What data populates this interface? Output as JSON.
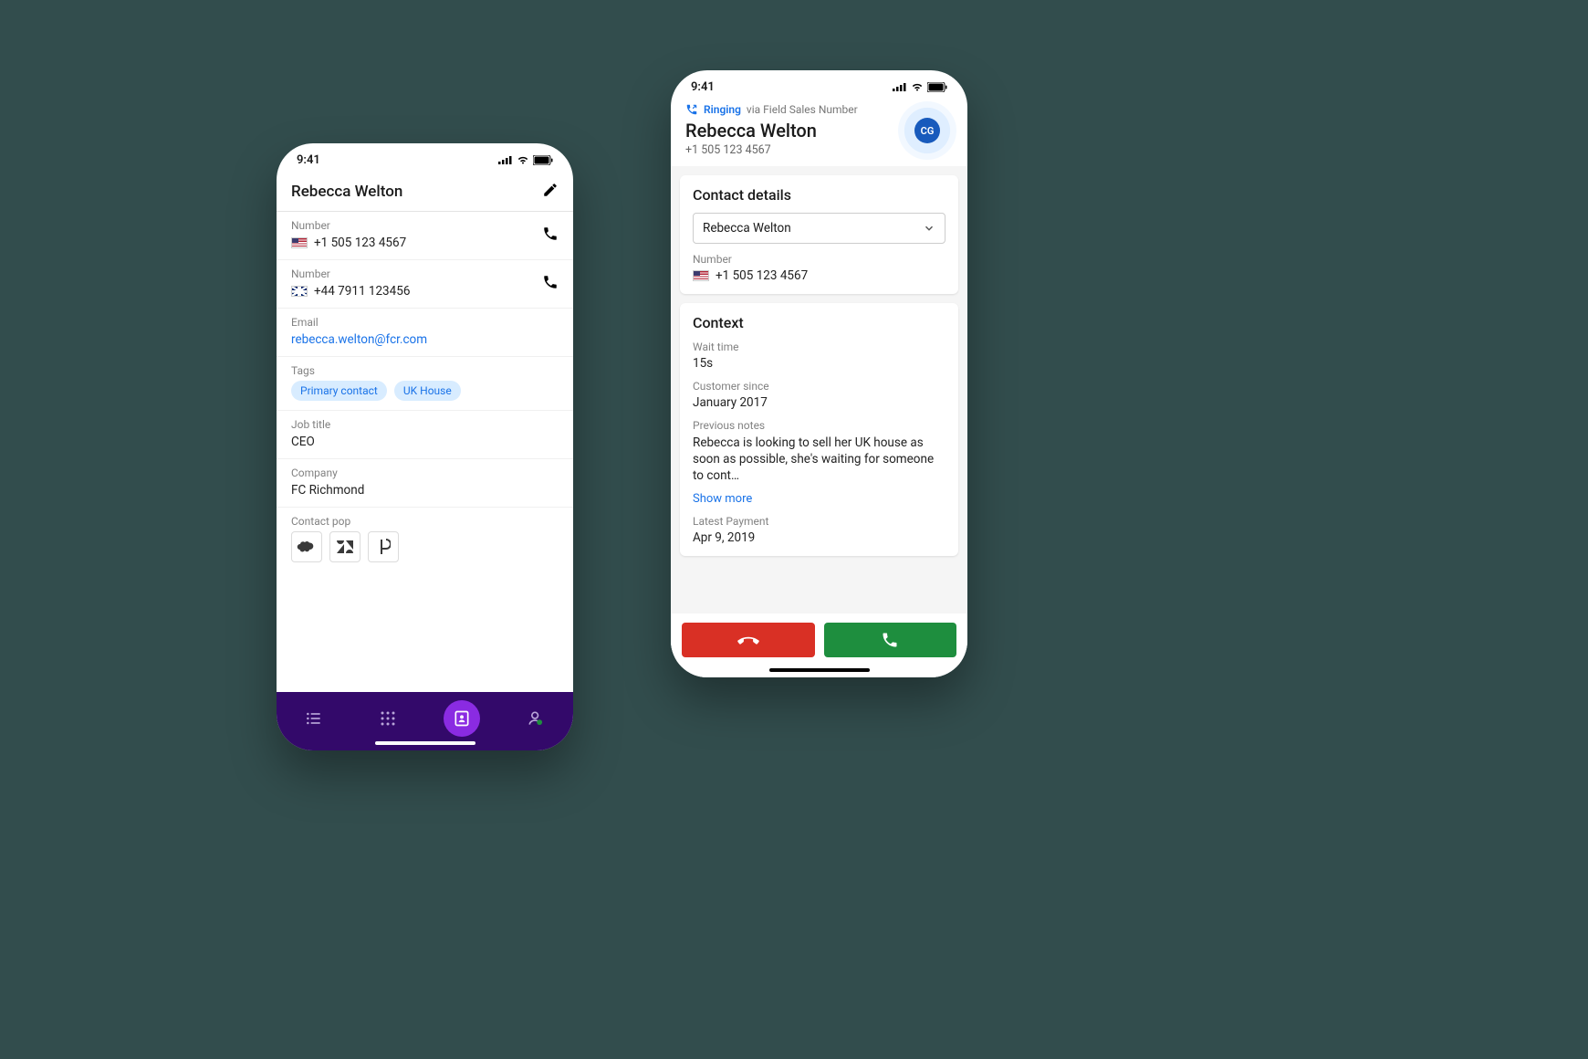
{
  "status": {
    "time": "9:41"
  },
  "phone1": {
    "title": "Rebecca Welton",
    "numbers": [
      {
        "label": "Number",
        "flag": "us",
        "value": "+1 505 123 4567"
      },
      {
        "label": "Number",
        "flag": "uk",
        "value": "+44 7911 123456"
      }
    ],
    "email": {
      "label": "Email",
      "value": "rebecca.welton@fcr.com"
    },
    "tags": {
      "label": "Tags",
      "items": [
        "Primary contact",
        "UK House"
      ]
    },
    "job": {
      "label": "Job title",
      "value": "CEO"
    },
    "company": {
      "label": "Company",
      "value": "FC Richmond"
    },
    "pop": {
      "label": "Contact pop",
      "items": [
        "salesforce",
        "zendesk",
        "dialpad"
      ]
    }
  },
  "phone2": {
    "status": "Ringing",
    "via": "via Field Sales Number",
    "name": "Rebecca Welton",
    "number": "+1 505 123 4567",
    "avatar": "CG",
    "contact": {
      "title": "Contact details",
      "selected": "Rebecca Welton",
      "numLabel": "Number",
      "numValue": "+1 505 123 4567"
    },
    "context": {
      "title": "Context",
      "wait": {
        "label": "Wait time",
        "value": "15s"
      },
      "since": {
        "label": "Customer since",
        "value": "January 2017"
      },
      "notes": {
        "label": "Previous notes",
        "value": "Rebecca is looking to sell her UK house as soon as possible, she's waiting for someone to cont…",
        "more": "Show more"
      },
      "latest": {
        "label": "Latest Payment",
        "value": "Apr 9, 2019"
      }
    }
  }
}
